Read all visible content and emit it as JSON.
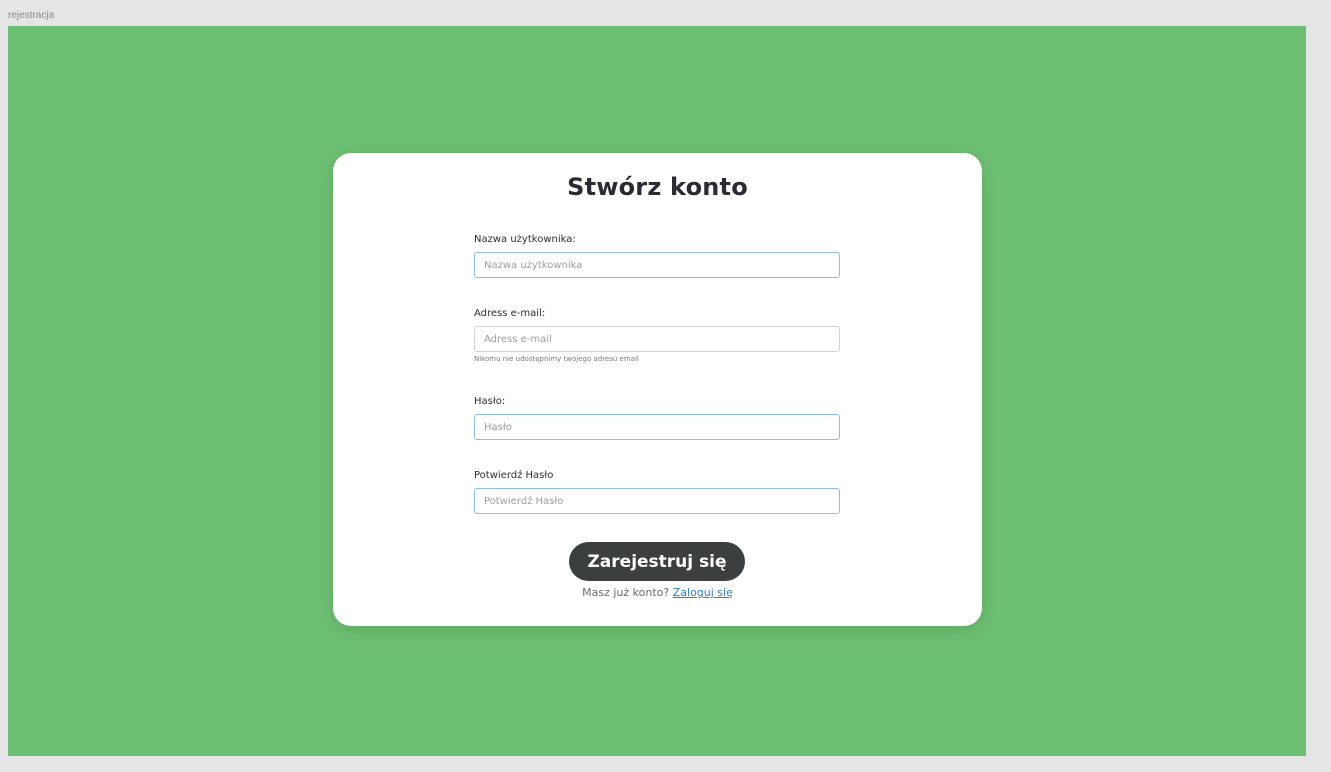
{
  "frame": {
    "label": "rejestracja",
    "background": "#6dbf73"
  },
  "form": {
    "title": "Stwórz konto",
    "fields": [
      {
        "label": "Nazwa użytkownika:",
        "placeholder": "Nazwa użytkownika",
        "value": ""
      },
      {
        "label": "Adress e-mail:",
        "placeholder": "Adress e-mail",
        "value": "",
        "help": "Nikomu nie udostępnimy twojego adresu email"
      },
      {
        "label": "Hasło:",
        "placeholder": "Hasło",
        "value": ""
      },
      {
        "label": "Potwierdź Hasło",
        "placeholder": "Potwierdź Hasło",
        "value": ""
      }
    ],
    "submit_label": "Zarejestruj się",
    "login_prompt": "Masz już konto?",
    "login_link": "Zaloguj się"
  },
  "colors": {
    "accent_button": "#3b3f40",
    "link": "#2f7fc4",
    "input_border_focus": "#8cbde3"
  }
}
